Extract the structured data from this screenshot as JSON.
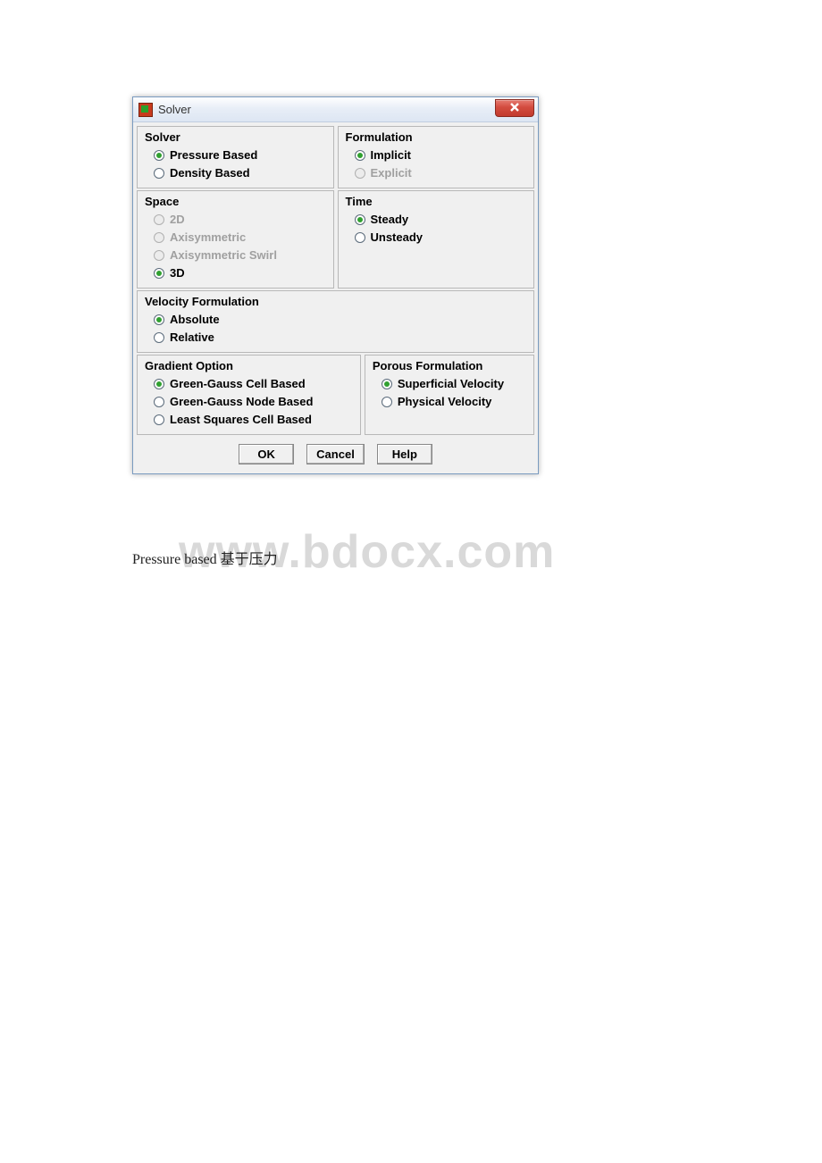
{
  "window": {
    "title": "Solver"
  },
  "groups": {
    "solver": {
      "title": "Solver",
      "options": {
        "pressure": "Pressure Based",
        "density": "Density Based"
      }
    },
    "formulation": {
      "title": "Formulation",
      "options": {
        "implicit": "Implicit",
        "explicit": "Explicit"
      }
    },
    "space": {
      "title": "Space",
      "options": {
        "d2": "2D",
        "axi": "Axisymmetric",
        "axiswirl": "Axisymmetric Swirl",
        "d3": "3D"
      }
    },
    "time": {
      "title": "Time",
      "options": {
        "steady": "Steady",
        "unsteady": "Unsteady"
      }
    },
    "velocity": {
      "title": "Velocity Formulation",
      "options": {
        "absolute": "Absolute",
        "relative": "Relative"
      }
    },
    "gradient": {
      "title": "Gradient Option",
      "options": {
        "ggcell": "Green-Gauss Cell Based",
        "ggnode": "Green-Gauss Node Based",
        "lsq": "Least Squares Cell Based"
      }
    },
    "porous": {
      "title": "Porous Formulation",
      "options": {
        "superficial": "Superficial Velocity",
        "physical": "Physical Velocity"
      }
    }
  },
  "buttons": {
    "ok": "OK",
    "cancel": "Cancel",
    "help": "Help"
  },
  "caption": "Pressure based 基于压力",
  "watermark": "www.bdocx.com"
}
